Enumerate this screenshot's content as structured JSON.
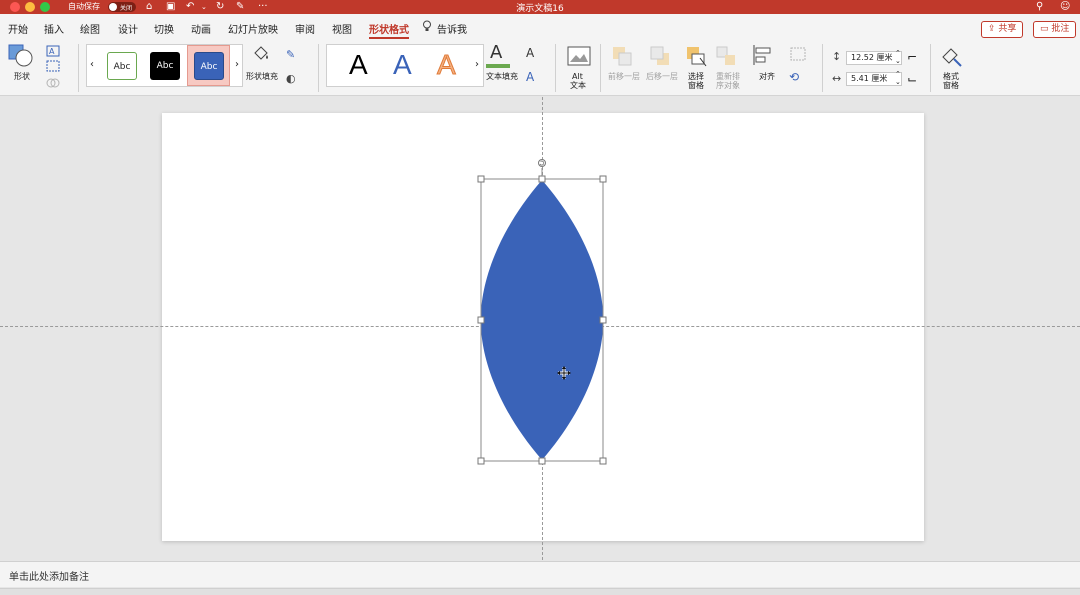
{
  "titlebar": {
    "autosave_label": "自动保存",
    "autosave_state": "关闭",
    "doc_title": "演示文稿16"
  },
  "tabs": [
    {
      "label": "开始"
    },
    {
      "label": "插入"
    },
    {
      "label": "绘图"
    },
    {
      "label": "设计"
    },
    {
      "label": "切换"
    },
    {
      "label": "动画"
    },
    {
      "label": "幻灯片放映"
    },
    {
      "label": "审阅"
    },
    {
      "label": "视图"
    },
    {
      "label": "形状格式",
      "active": true
    }
  ],
  "tell_me": "告诉我",
  "share_button": "共享",
  "comments_button": "批注",
  "ribbon": {
    "shapes_label": "形状",
    "style_boxes": [
      "Abc",
      "Abc",
      "Abc"
    ],
    "shape_fill_label": "形状填充",
    "wordart_letters": [
      "A",
      "A",
      "A"
    ],
    "text_fill_label": "文本填充",
    "alt_text_label_1": "Alt",
    "alt_text_label_2": "文本",
    "bring_forward_label": "前移一层",
    "send_backward_label": "后移一层",
    "selection_pane_label_1": "选择",
    "selection_pane_label_2": "窗格",
    "reorder_label_1": "重新排",
    "reorder_label_2": "序对象",
    "align_label": "对齐",
    "height_value": "12.52 厘米",
    "width_value": "5.41 厘米",
    "format_pane_label_1": "格式",
    "format_pane_label_2": "窗格"
  },
  "notes_placeholder": "单击此处添加备注",
  "colors": {
    "accent": "#c0392b",
    "shape_fill": "#3a63b8"
  },
  "icons": [
    "close-window-icon",
    "minimize-window-icon",
    "zoom-window-icon",
    "home-icon",
    "save-icon",
    "undo-icon",
    "redo-icon",
    "customize-icon",
    "more-icon",
    "search-icon",
    "account-icon",
    "lightbulb-icon",
    "move-cursor-icon",
    "rotate-handle-icon"
  ]
}
